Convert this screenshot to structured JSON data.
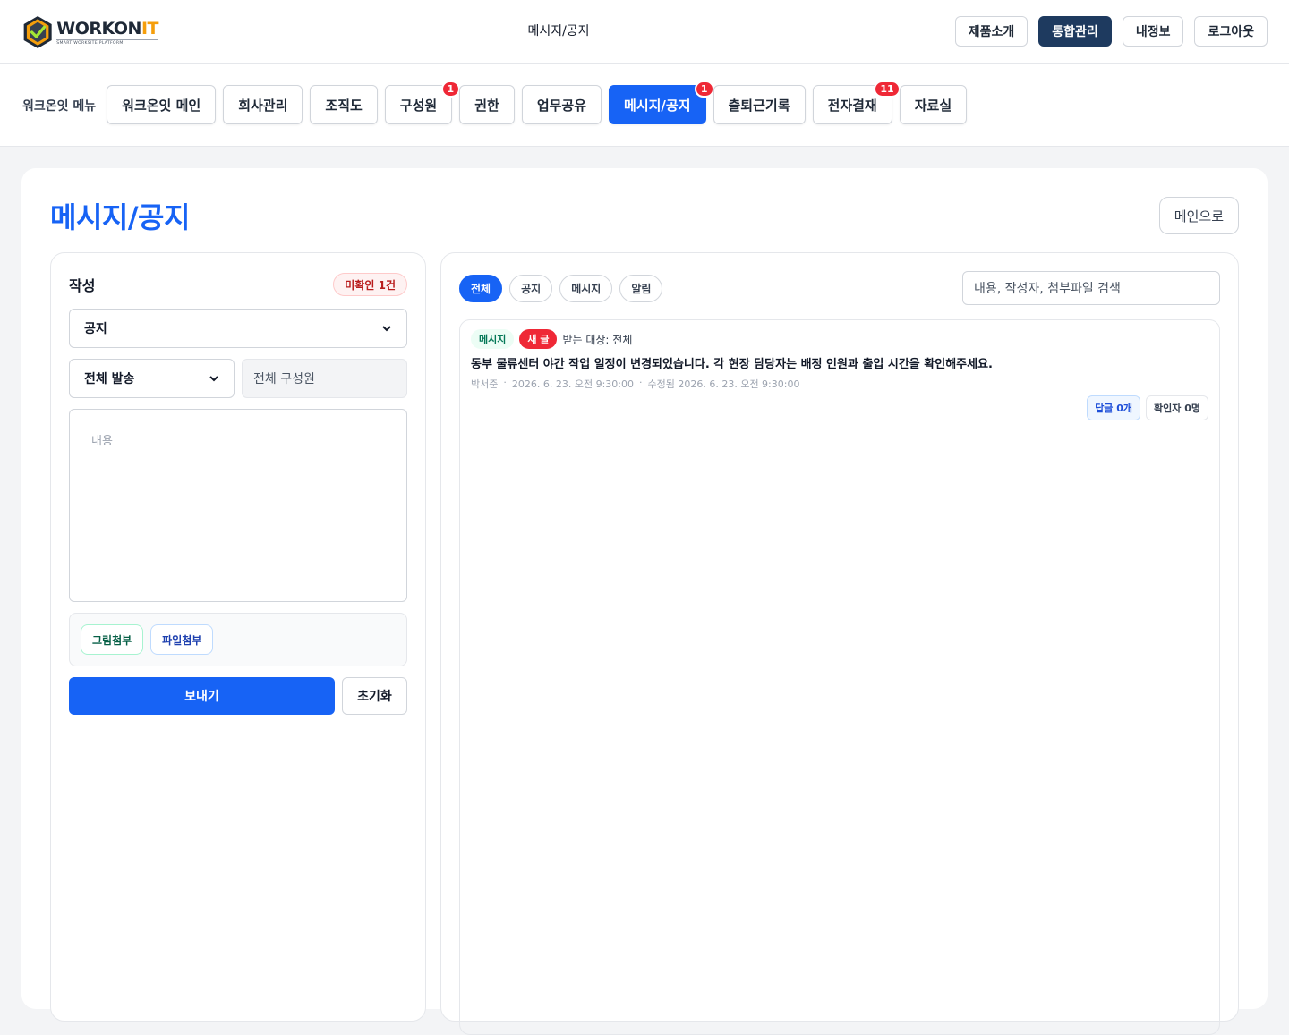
{
  "header": {
    "logo_word_main": "WORKON",
    "logo_word_accent": "IT",
    "logo_sub": "SMART WORKSITE PLATFORM",
    "center_title": "메시지/공지",
    "buttons": [
      "제품소개",
      "통합관리",
      "내정보",
      "로그아웃"
    ]
  },
  "menu": {
    "label": "워크온잇 메뉴",
    "items": [
      {
        "label": "워크온잇 메인",
        "badge": null,
        "active": false
      },
      {
        "label": "회사관리",
        "badge": null,
        "active": false
      },
      {
        "label": "조직도",
        "badge": null,
        "active": false
      },
      {
        "label": "구성원",
        "badge": "1",
        "active": false
      },
      {
        "label": "권한",
        "badge": null,
        "active": false
      },
      {
        "label": "업무공유",
        "badge": null,
        "active": false
      },
      {
        "label": "메시지/공지",
        "badge": "1",
        "active": true
      },
      {
        "label": "출퇴근기록",
        "badge": null,
        "active": false
      },
      {
        "label": "전자결재",
        "badge": "11",
        "active": false
      },
      {
        "label": "자료실",
        "badge": null,
        "active": false
      }
    ]
  },
  "page": {
    "title": "메시지/공지",
    "back_label": "메인으로"
  },
  "compose": {
    "title": "작성",
    "unread": "미확인 1건",
    "type_select": "공지",
    "target_select": "전체 발송",
    "recipients": "전체 구성원",
    "content_placeholder": "내용",
    "attach_image": "그림첨부",
    "attach_file": "파일첨부",
    "send": "보내기",
    "reset": "초기화"
  },
  "list": {
    "filters": [
      "전체",
      "공지",
      "메시지",
      "알림"
    ],
    "active_filter": "전체",
    "search_placeholder": "내용, 작성자, 첨부파일 검색",
    "items": [
      {
        "type": "메시지",
        "new_tag": "새 글",
        "receiver": "받는 대상: 전체",
        "body": "동부 물류센터 야간 작업 일정이 변경되었습니다. 각 현장 담당자는 배정 인원과 출입 시간을 확인해주세요.",
        "author": "박서준",
        "created": "2026. 6. 23. 오전 9:30:00",
        "modified": "수정됨 2026. 6. 23. 오전 9:30:00",
        "reply": "답글 0개",
        "readers": "확인자 0명"
      }
    ]
  },
  "colors": {
    "primary": "#1763f5",
    "navy": "#1e3a5f",
    "badge_red": "#ef2836",
    "accent_orange": "#f59e0b"
  }
}
